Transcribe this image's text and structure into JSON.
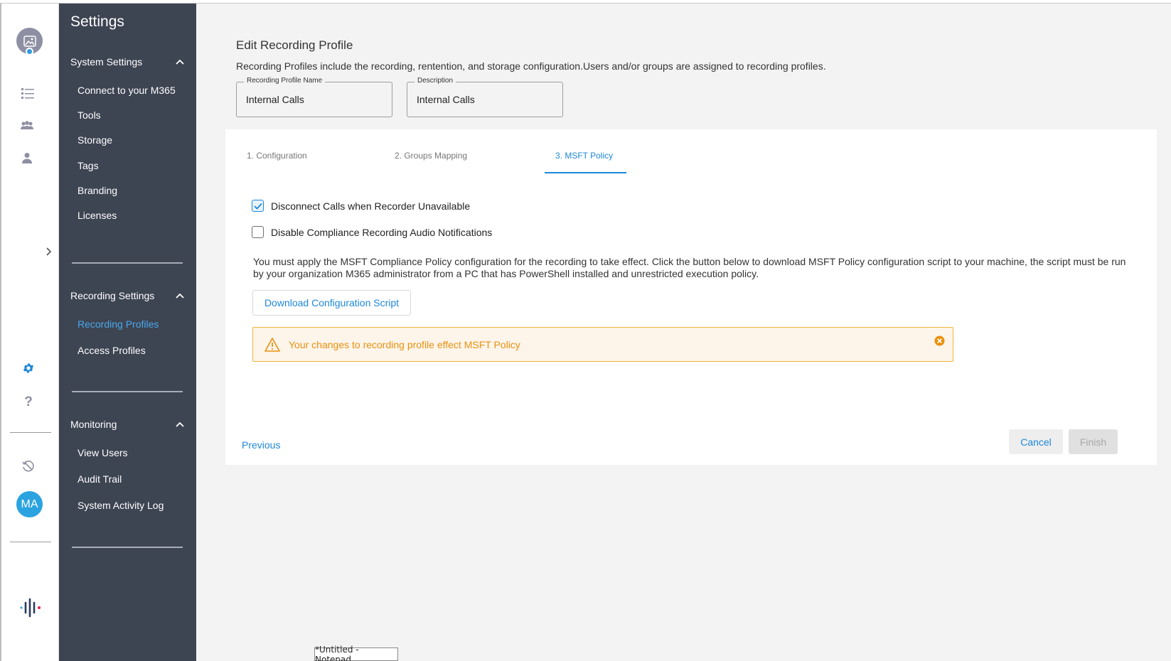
{
  "sidebar": {
    "title": "Settings",
    "sections": [
      {
        "label": "System Settings",
        "items": [
          "Connect to your M365",
          "Tools",
          "Storage",
          "Tags",
          "Branding",
          "Licenses"
        ]
      },
      {
        "label": "Recording Settings",
        "items": [
          "Recording Profiles",
          "Access Profiles"
        ]
      },
      {
        "label": "Monitoring",
        "items": [
          "View Users",
          "Audit Trail",
          "System Activity Log"
        ]
      }
    ],
    "active_item": "Recording Profiles"
  },
  "rail": {
    "user_initials": "MA",
    "icons": [
      "image-avatar-icon",
      "list-icon",
      "group-icon",
      "person-icon",
      "chevron-right-icon",
      "gear-icon",
      "help-icon",
      "history-icon",
      "brand-logo-icon"
    ]
  },
  "page": {
    "title": "Edit Recording Profile",
    "description": "Recording Profiles include the recording, rentention, and storage configuration.Users and/or groups are assigned to recording profiles.",
    "fields": {
      "name": {
        "label": "Recording Profile Name",
        "value": "Internal Calls"
      },
      "description": {
        "label": "Description",
        "value": "Internal Calls"
      }
    }
  },
  "tabs": [
    "1. Configuration",
    "2. Groups Mapping",
    "3. MSFT Policy"
  ],
  "active_tab": "3. MSFT Policy",
  "options": [
    {
      "label": "Disconnect Calls when Recorder Unavailable",
      "checked": true
    },
    {
      "label": "Disable Compliance Recording Audio Notifications",
      "checked": false
    }
  ],
  "info_text": "You must apply the MSFT Compliance Policy configuration for the recording to take effect. Click the button below to download MSFT Policy configuration script to your machine, the script must be run by your organization M365 administrator from a PC that has PowerShell installed and unrestricted execution policy.",
  "download_button": "Download Configuration Script",
  "warning": {
    "text": "Your changes to recording profile effect MSFT Policy",
    "color": "#e8920f"
  },
  "footer": {
    "previous": "Previous",
    "cancel": "Cancel",
    "finish": "Finish"
  },
  "taskbar": {
    "label": "*Untitled - Notepad"
  },
  "colors": {
    "accent": "#1e88d8",
    "sidebar_bg": "#3d4452",
    "active_nav": "#4aa8ec",
    "warning_border": "#f0b43a"
  }
}
